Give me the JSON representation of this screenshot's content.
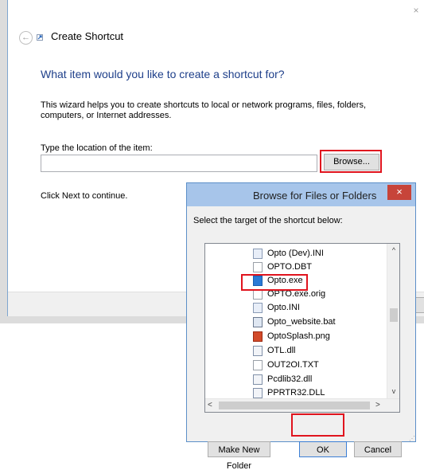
{
  "wizard": {
    "close_glyph": "×",
    "back_glyph": "←",
    "title": "Create Shortcut",
    "heading": "What item would you like to create a shortcut for?",
    "description": "This wizard helps you to create shortcuts to local or network programs, files, folders, computers, or Internet addresses.",
    "location_label": "Type the location of the item:",
    "location_value": "",
    "browse_label": "Browse...",
    "next_hint": "Click Next to continue."
  },
  "browse_dialog": {
    "title": "Browse for Files or Folders",
    "close_glyph": "×",
    "instruction": "Select the target of the shortcut below:",
    "items": [
      {
        "label": "Opto (Dev).INI",
        "icon": "ini-file-icon"
      },
      {
        "label": "OPTO.DBT",
        "icon": "document-icon"
      },
      {
        "label": "Opto.exe",
        "icon": "exe-file-icon"
      },
      {
        "label": "OPTO.exe.orig",
        "icon": "document-icon"
      },
      {
        "label": "Opto.INI",
        "icon": "ini-file-icon"
      },
      {
        "label": "Opto_website.bat",
        "icon": "batch-file-icon"
      },
      {
        "label": "OptoSplash.png",
        "icon": "image-file-icon"
      },
      {
        "label": "OTL.dll",
        "icon": "dll-file-icon"
      },
      {
        "label": "OUT2OI.TXT",
        "icon": "document-icon"
      },
      {
        "label": "Pcdlib32.dll",
        "icon": "dll-file-icon"
      },
      {
        "label": "PPRTR32.DLL",
        "icon": "dll-file-icon"
      }
    ],
    "scroll_up": "^",
    "scroll_down": "v",
    "scroll_left": "<",
    "scroll_right": ">",
    "make_new_folder_label": "Make New Folder",
    "ok_label": "OK",
    "cancel_label": "Cancel"
  },
  "colors": {
    "highlight": "#e0141e",
    "heading": "#1e3f8a",
    "titlebar": "#a7c5ea",
    "close": "#c7443a"
  }
}
